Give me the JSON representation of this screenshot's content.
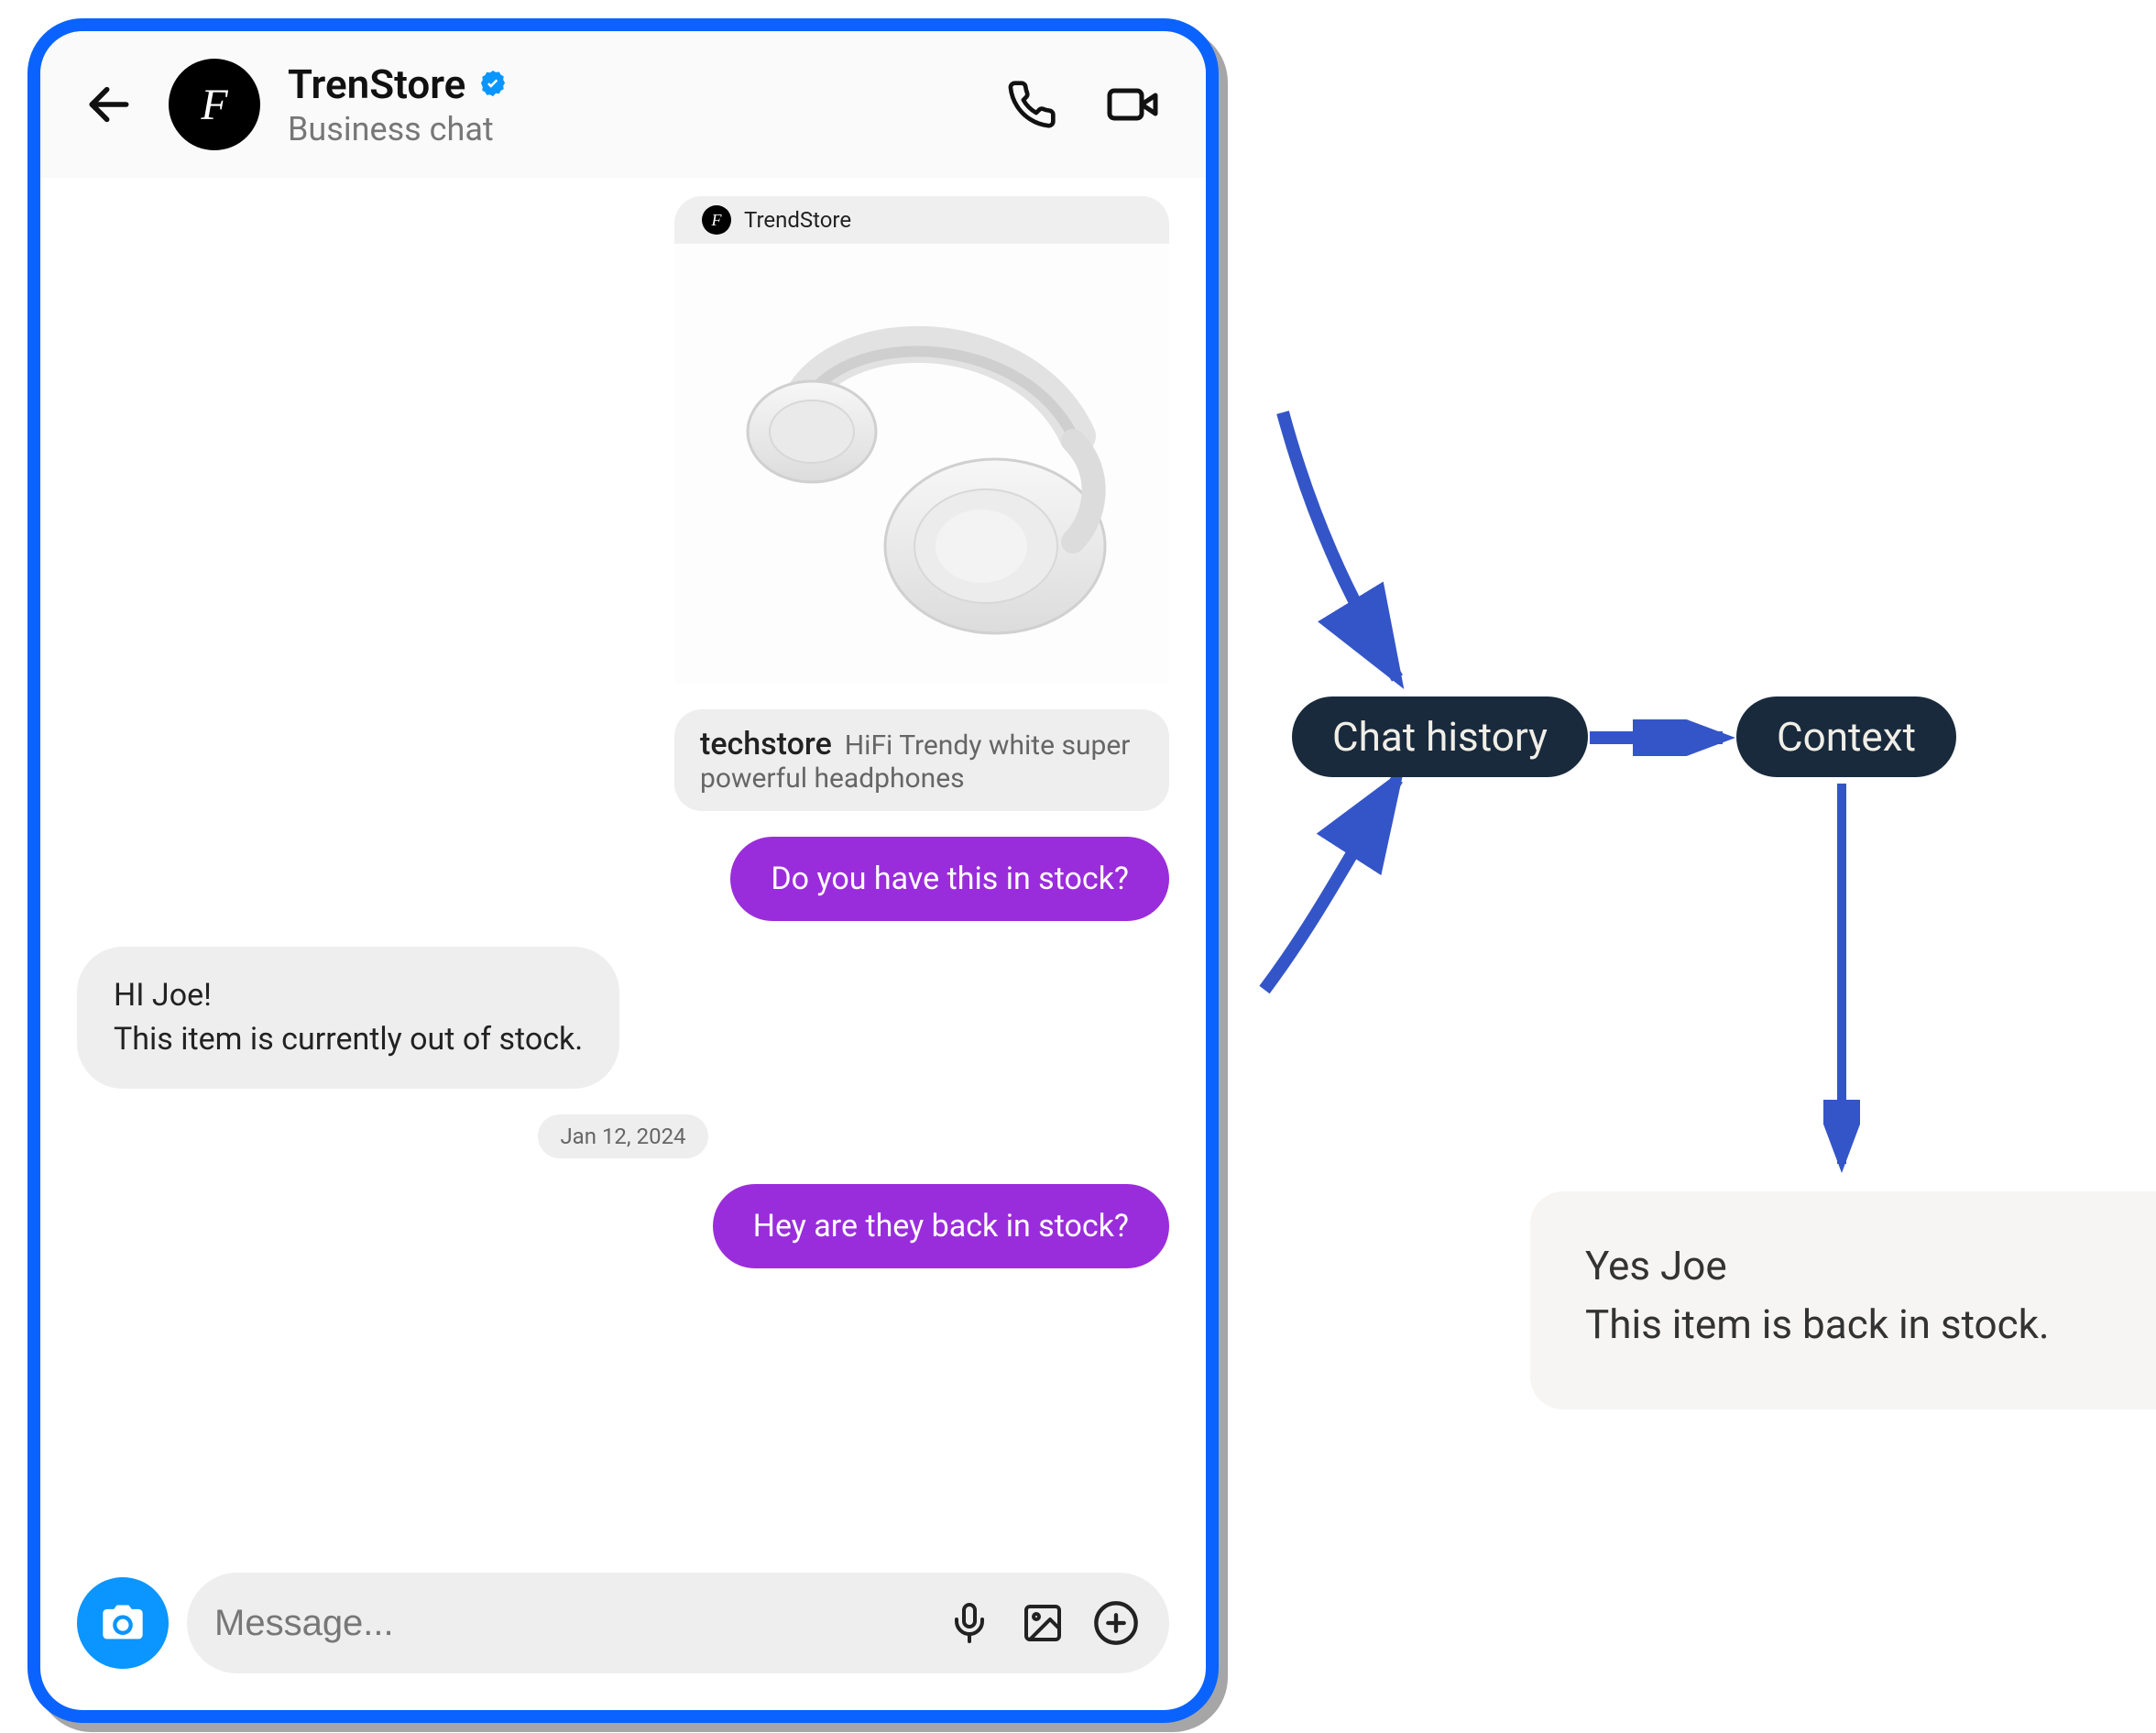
{
  "header": {
    "title": "TrenStore",
    "subtitle": "Business chat",
    "avatar_glyph": "F"
  },
  "attachment": {
    "brand": "TrendStore",
    "avatar_glyph": "F",
    "shop_handle": "techstore",
    "description": "HiFi Trendy white super powerful headphones"
  },
  "messages": {
    "out1": "Do you have this in stock?",
    "in1_line1": "HI Joe!",
    "in1_line2": "This item is currently out of stock.",
    "date": "Jan 12, 2024",
    "out2": "Hey are they back in stock?"
  },
  "composer": {
    "placeholder": "Message..."
  },
  "diagram": {
    "chat_history": "Chat history",
    "context": "Context",
    "reply_line1": "Yes Joe",
    "reply_line2": "This item is back in stock."
  }
}
